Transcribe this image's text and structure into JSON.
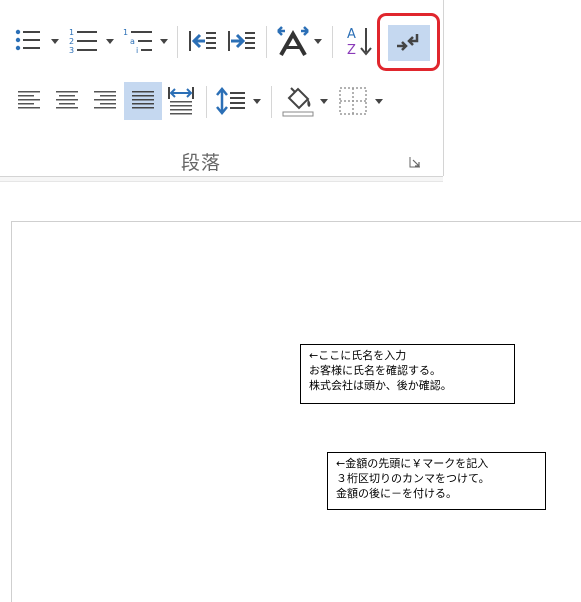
{
  "ribbon": {
    "group_label": "段落",
    "row1": [
      {
        "name": "bullets",
        "icon": "bullet-list-icon"
      },
      {
        "name": "numbering",
        "icon": "numbered-list-icon"
      },
      {
        "name": "multilevel",
        "icon": "multilevel-list-icon"
      },
      {
        "name": "decrease-indent",
        "icon": "decrease-indent-icon"
      },
      {
        "name": "increase-indent",
        "icon": "increase-indent-icon"
      },
      {
        "name": "text-direction",
        "icon": "character-spacing-icon"
      },
      {
        "name": "sort",
        "icon": "sort-az-icon"
      },
      {
        "name": "show-formatting",
        "icon": "paragraph-mark-arrow-icon"
      }
    ],
    "sort_letters": {
      "top": "A",
      "bottom": "Z"
    },
    "number_glyphs": [
      "1",
      "2",
      "3"
    ],
    "multilevel_glyphs": [
      "1",
      "a",
      "i"
    ],
    "row2": [
      {
        "name": "align-left",
        "icon": "align-left-icon"
      },
      {
        "name": "center",
        "icon": "align-center-icon"
      },
      {
        "name": "align-right",
        "icon": "align-right-icon"
      },
      {
        "name": "justify",
        "icon": "justify-icon",
        "selected": true
      },
      {
        "name": "distributed",
        "icon": "distribute-icon"
      },
      {
        "name": "line-spacing",
        "icon": "line-spacing-icon"
      },
      {
        "name": "shading",
        "icon": "shading-bucket-icon"
      },
      {
        "name": "borders",
        "icon": "borders-icon"
      }
    ],
    "colors": {
      "icon_blue": "#2b6fb6",
      "icon_gray": "#444444",
      "selected_bg": "#c5d8f0",
      "highlight_red": "#e0262d",
      "sort_a": "#2b6fb6",
      "sort_z": "#8a3ab9"
    }
  },
  "document": {
    "note1": {
      "lines": [
        "←ここに氏名を入力",
        "お客様に氏名を確認する。",
        "株式会社は頭か、後か確認。"
      ]
    },
    "note2": {
      "lines": [
        "←金額の先頭に￥マークを記入",
        "３桁区切りのカンマをつけて。",
        "金額の後に－を付ける。"
      ]
    }
  }
}
